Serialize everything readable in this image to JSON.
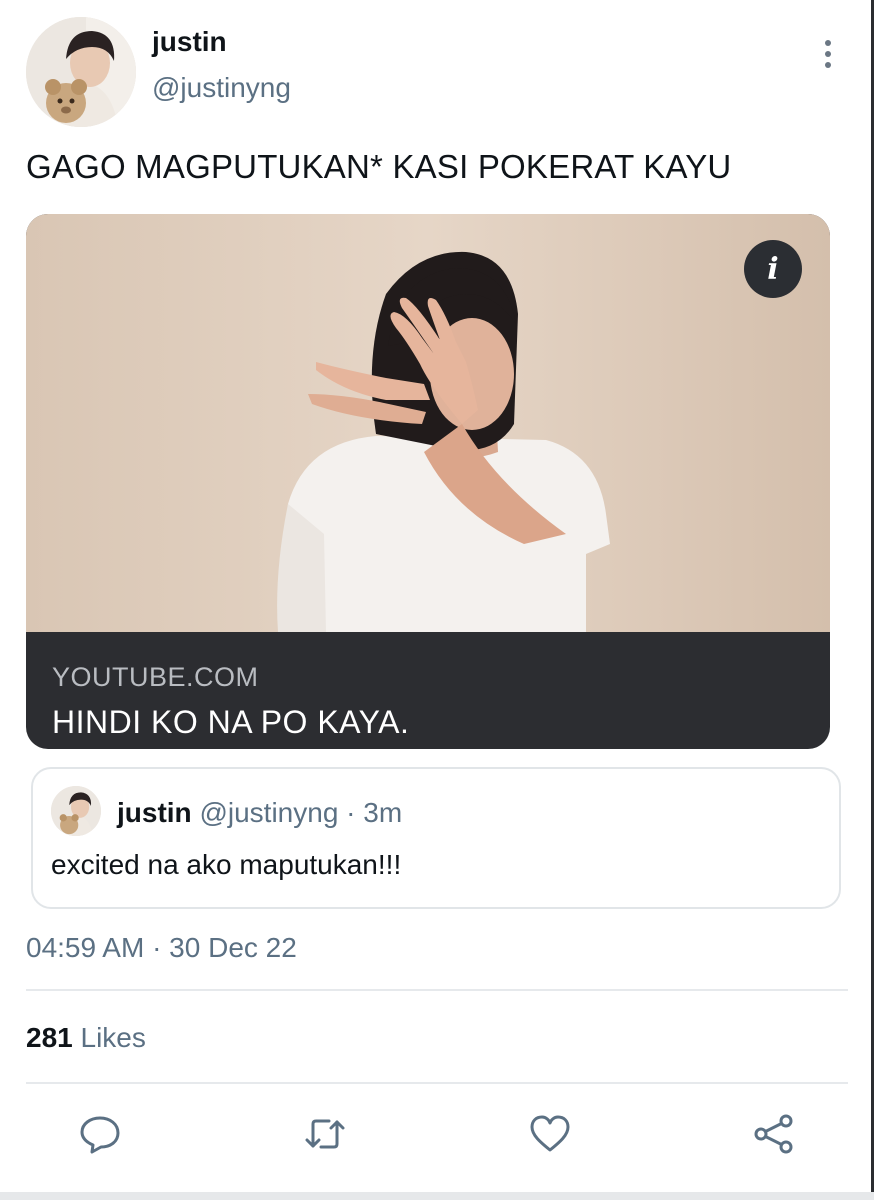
{
  "tweet": {
    "author_name": "justin",
    "author_handle": "@justinyng",
    "text": "GAGO MAGPUTUKAN* KASI POKERAT KAYU"
  },
  "link_card": {
    "domain": "YOUTUBE.COM",
    "title": "HINDI KO NA PO KAYA.",
    "info_icon": "info-icon"
  },
  "quoted_tweet": {
    "author_name": "justin",
    "author_handle": "@justinyng",
    "separator": "·",
    "time": "3m",
    "text": "excited na ako maputukan!!!"
  },
  "timestamp": "04:59 AM · 30 Dec 22",
  "stats": {
    "likes_count": "281",
    "likes_label": "Likes"
  },
  "actions": [
    "reply-icon",
    "retweet-icon",
    "like-icon",
    "share-icon"
  ],
  "colors": {
    "text": "#0f1419",
    "secondary": "#5b7083",
    "card_caption_bg": "#2c2d31",
    "border": "#e1e5e8"
  }
}
